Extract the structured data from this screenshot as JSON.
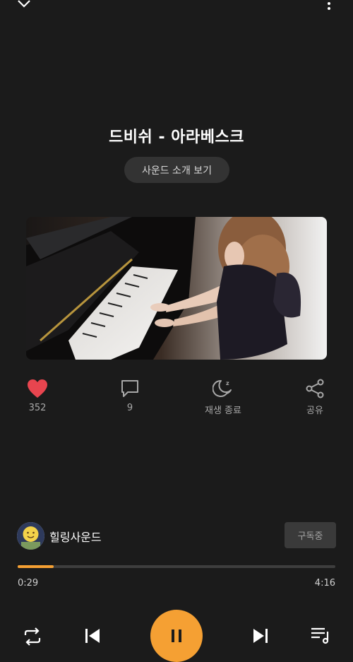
{
  "track": {
    "title": "드비쉬 - 아라베스크",
    "intro_button": "사운드 소개 보기"
  },
  "actions": {
    "like": {
      "icon": "heart-icon",
      "label": "352",
      "color": "#e8454f"
    },
    "comment": {
      "icon": "comment-icon",
      "label": "9"
    },
    "sleep_timer": {
      "icon": "moon-sleep-icon",
      "label": "재생 종료"
    },
    "share": {
      "icon": "share-icon",
      "label": "공유"
    }
  },
  "channel": {
    "name": "힐링사운드",
    "subscribe_label": "구독중"
  },
  "player": {
    "elapsed": "0:29",
    "duration": "4:16",
    "progress_fraction": 0.113,
    "state": "playing"
  },
  "colors": {
    "accent": "#f5a033",
    "background": "#1b1b1b"
  }
}
